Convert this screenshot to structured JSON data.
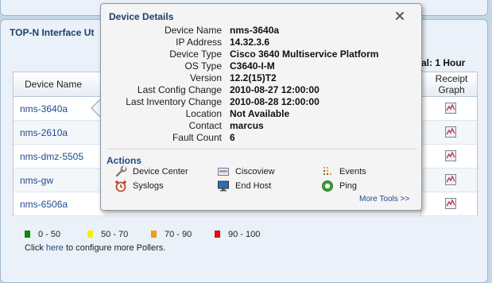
{
  "panel": {
    "title": "TOP-N Interface Ut",
    "interval": "al: 1 Hour"
  },
  "grid": {
    "headers": {
      "device": "Device Name",
      "receipt": "Receipt Graph"
    },
    "rows": [
      {
        "device": "nms-3640a"
      },
      {
        "device": "nms-2610a"
      },
      {
        "device": "nms-dmz-5505"
      },
      {
        "device": "nms-gw"
      },
      {
        "device": "nms-6506a"
      }
    ]
  },
  "legend": [
    {
      "label": "0 - 50",
      "color": "#0a8a0a"
    },
    {
      "label": "50 - 70",
      "color": "#f2f200"
    },
    {
      "label": "70 - 90",
      "color": "#f39a1a"
    },
    {
      "label": "90 - 100",
      "color": "#e01010"
    }
  ],
  "configure": {
    "prefix": "Click ",
    "link": "here",
    "suffix": " to configure more Pollers."
  },
  "popup": {
    "title": "Device Details",
    "close": "close-icon",
    "details": [
      {
        "label": "Device Name",
        "value": "nms-3640a"
      },
      {
        "label": "IP Address",
        "value": "14.32.3.6"
      },
      {
        "label": "Device Type",
        "value": "Cisco 3640 Multiservice Platform"
      },
      {
        "label": "OS Type",
        "value": "C3640-I-M"
      },
      {
        "label": "Version",
        "value": "12.2(15)T2"
      },
      {
        "label": "Last Config Change",
        "value": "2010-08-27 12:00:00"
      },
      {
        "label": "Last Inventory Change",
        "value": "2010-08-28 12:00:00"
      },
      {
        "label": "Location",
        "value": "Not Available"
      },
      {
        "label": "Contact",
        "value": "marcus"
      },
      {
        "label": "Fault Count",
        "value": "6"
      }
    ],
    "actions_title": "Actions",
    "actions": [
      {
        "label": "Device Center",
        "icon": "wrench-icon"
      },
      {
        "label": "Ciscoview",
        "icon": "ciscoview-icon"
      },
      {
        "label": "Events",
        "icon": "events-icon"
      },
      {
        "label": "Syslogs",
        "icon": "alarm-clock-icon"
      },
      {
        "label": "End Host",
        "icon": "monitor-icon"
      },
      {
        "label": "Ping",
        "icon": "ping-icon"
      }
    ],
    "more_tools": "More Tools >>"
  }
}
